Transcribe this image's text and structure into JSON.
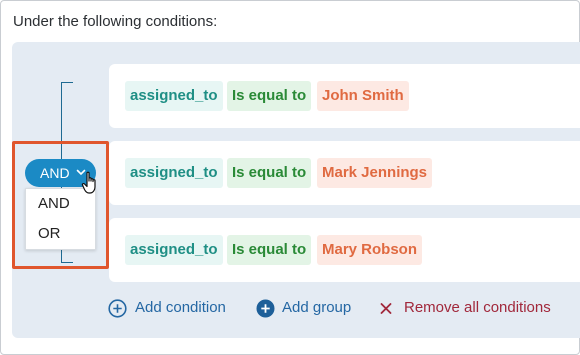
{
  "heading": "Under the following conditions:",
  "operator_button": {
    "label": "AND"
  },
  "operator_menu": {
    "options": [
      "AND",
      "OR"
    ]
  },
  "conditions": [
    {
      "field": "assigned_to",
      "operator": "Is equal to",
      "value": "John Smith"
    },
    {
      "field": "assigned_to",
      "operator": "Is equal to",
      "value": "Mark Jennings"
    },
    {
      "field": "assigned_to",
      "operator": "Is equal to",
      "value": "Mary Robson"
    }
  ],
  "actions": {
    "add_condition": "Add condition",
    "add_group": "Add group",
    "remove_all": "Remove all conditions"
  },
  "colors": {
    "field_text": "#1f8f85",
    "operator_text": "#2a8a37",
    "value_text": "#e06a41",
    "and_button": "#1b8ac5",
    "highlight_border": "#e0562d",
    "remove_text": "#a1283b"
  }
}
